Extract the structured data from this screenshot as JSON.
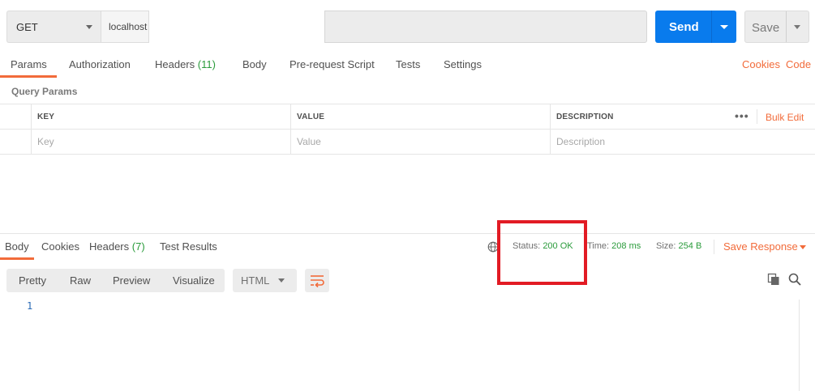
{
  "request": {
    "method": "GET",
    "url": "localhost",
    "send_label": "Send",
    "save_label": "Save"
  },
  "request_tabs": {
    "params": "Params",
    "authorization": "Authorization",
    "headers": "Headers",
    "headers_count": "(11)",
    "body": "Body",
    "pre_request": "Pre-request Script",
    "tests": "Tests",
    "settings": "Settings",
    "cookies": "Cookies",
    "code": "Code"
  },
  "query_params": {
    "title": "Query Params",
    "columns": {
      "key": "KEY",
      "value": "VALUE",
      "description": "DESCRIPTION"
    },
    "placeholders": {
      "key": "Key",
      "value": "Value",
      "description": "Description"
    },
    "more": "•••",
    "bulk_edit": "Bulk Edit"
  },
  "response_tabs": {
    "body": "Body",
    "cookies": "Cookies",
    "headers": "Headers",
    "headers_count": "(7)",
    "test_results": "Test Results"
  },
  "response_meta": {
    "status_label": "Status:",
    "status_value": "200 OK",
    "time_label": "Time:",
    "time_value": "208 ms",
    "size_label": "Size:",
    "size_value": "254 B",
    "save_response": "Save Response"
  },
  "response_view": {
    "modes": [
      "Pretty",
      "Raw",
      "Preview",
      "Visualize"
    ],
    "format": "HTML",
    "line_number": "1"
  },
  "colors": {
    "accent": "#f26b3a",
    "send": "#097bed",
    "success": "#2a9b3b",
    "highlight": "#e21b24"
  }
}
